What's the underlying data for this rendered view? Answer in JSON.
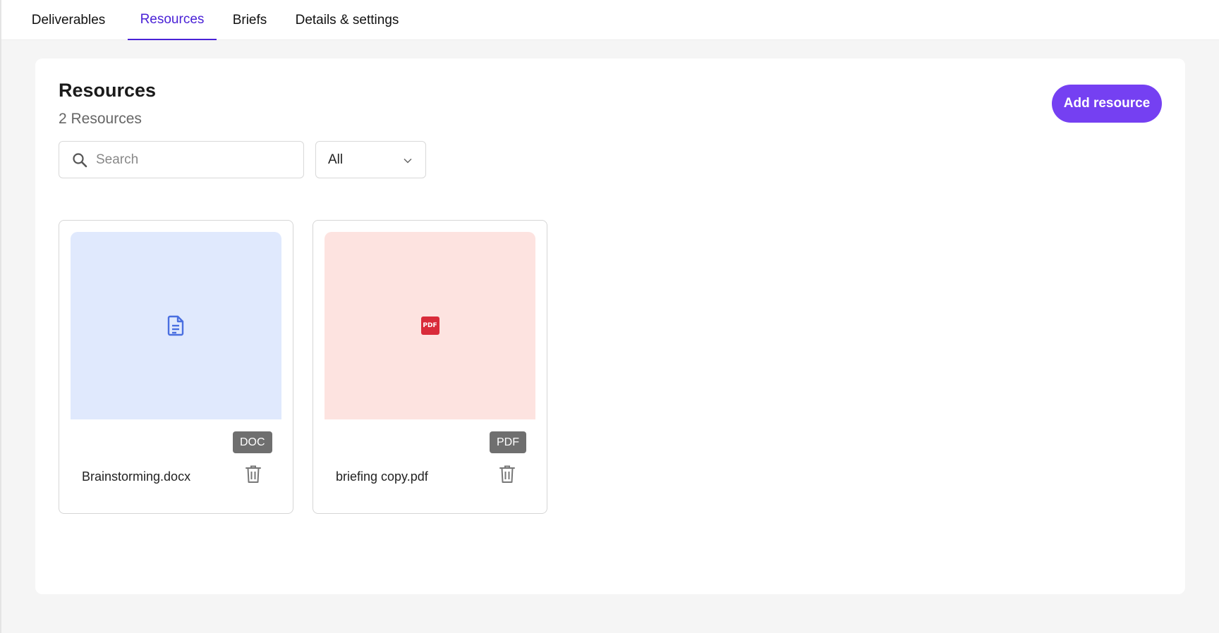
{
  "tabs": [
    {
      "label": "Deliverables",
      "active": false
    },
    {
      "label": "Resources",
      "active": true
    },
    {
      "label": "Briefs",
      "active": false
    },
    {
      "label": "Details & settings",
      "active": false
    }
  ],
  "header": {
    "title": "Resources",
    "count_label": "2 Resources",
    "add_button_label": "Add resource"
  },
  "search": {
    "placeholder": "Search",
    "value": "",
    "icon": "search-icon"
  },
  "filter": {
    "selected": "All",
    "icon": "chevron-down-icon"
  },
  "resources": [
    {
      "name": "Brainstorming.docx",
      "type_badge": "DOC",
      "icon": "document-icon",
      "thumb_color": "#e0e9fd",
      "icon_color": "#4a6fe0"
    },
    {
      "name": "briefing copy.pdf",
      "type_badge": "PDF",
      "icon": "pdf-icon",
      "icon_text": "PDF",
      "thumb_color": "#fde3e0",
      "icon_color": "#d92b3a"
    }
  ],
  "colors": {
    "accent": "#4a22d6",
    "button": "#7540f2",
    "badge": "#6f6f6f"
  }
}
